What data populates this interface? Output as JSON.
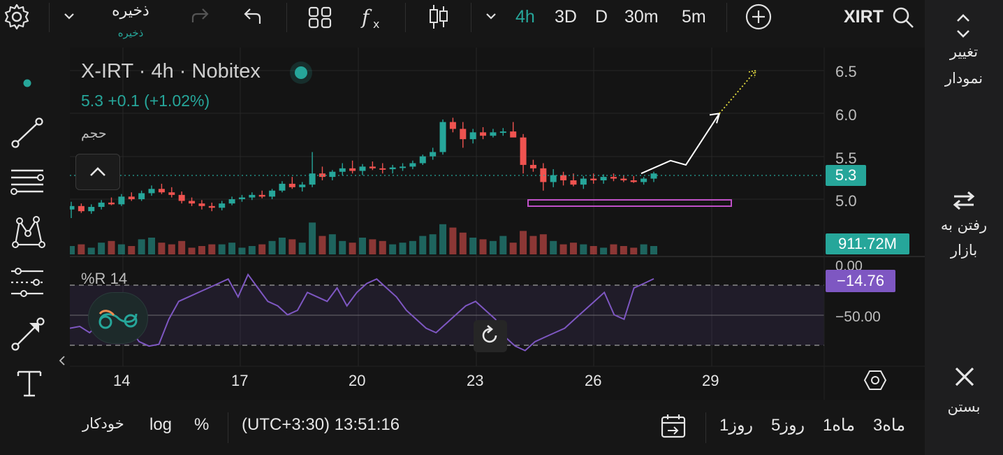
{
  "toolbar": {
    "save_label": "ذخیره",
    "save_sublabel": "ذخیره",
    "timeframes": [
      "4h",
      "3D",
      "D",
      "30m",
      "5m"
    ],
    "active_timeframe": "4h",
    "symbol": "XIRT"
  },
  "legend": {
    "title": "X-IRT",
    "interval": "4h",
    "exchange": "Nobitex",
    "last": "5.3",
    "change": "+0.1",
    "change_pct": "(+1.02%)",
    "volume_label": "حجم",
    "indicator_label": "%R",
    "indicator_period": "14"
  },
  "price_axis": {
    "ticks": [
      "6.5",
      "6.0",
      "5.5",
      "5.0"
    ],
    "last_price_badge": "5.3",
    "volume_badge": "911.72M"
  },
  "indicator_axis": {
    "ticks": [
      "0.00",
      "−50.00"
    ],
    "value_badge": "−14.76"
  },
  "time_axis": {
    "ticks": [
      "14",
      "17",
      "20",
      "23",
      "26",
      "29"
    ]
  },
  "right_panel": {
    "change_chart": [
      "تغییر",
      "نمودار"
    ],
    "go_to_market": [
      "رفتن به",
      "بازار"
    ],
    "close": "بستن"
  },
  "bottom_bar": {
    "auto": "خودکار",
    "log": "log",
    "percent": "%",
    "time": "(UTC+3:30) 13:51:16",
    "ranges": [
      "1روز",
      "5روز",
      "1ماه",
      "3ماه"
    ]
  },
  "colors": {
    "up": "#26a69a",
    "down": "#ef5350",
    "indicator": "#7e57c2",
    "accent": "#26a69a",
    "rectangle": "#c050c8"
  },
  "chart_data": {
    "type": "candlestick",
    "x_ticks": [
      "14",
      "17",
      "20",
      "23",
      "26",
      "29"
    ],
    "price_ylim": [
      4.75,
      6.6
    ],
    "williams_r_ylim": [
      -100,
      0
    ],
    "candles_ohlc": [
      [
        4.88,
        4.97,
        4.78,
        4.92
      ],
      [
        4.92,
        4.95,
        4.84,
        4.86
      ],
      [
        4.86,
        4.94,
        4.83,
        4.91
      ],
      [
        4.91,
        4.99,
        4.88,
        4.96
      ],
      [
        4.96,
        5.02,
        4.93,
        4.94
      ],
      [
        4.94,
        5.06,
        4.92,
        5.03
      ],
      [
        5.03,
        5.08,
        4.98,
        5.0
      ],
      [
        5.0,
        5.1,
        4.98,
        5.07
      ],
      [
        5.07,
        5.16,
        5.04,
        5.12
      ],
      [
        5.12,
        5.18,
        5.06,
        5.08
      ],
      [
        5.08,
        5.14,
        5.02,
        5.05
      ],
      [
        5.05,
        5.09,
        4.95,
        4.98
      ],
      [
        4.98,
        5.02,
        4.92,
        4.95
      ],
      [
        4.95,
        4.99,
        4.88,
        4.92
      ],
      [
        4.92,
        4.96,
        4.86,
        4.9
      ],
      [
        4.9,
        4.98,
        4.87,
        4.95
      ],
      [
        4.95,
        5.03,
        4.93,
        5.0
      ],
      [
        5.0,
        5.05,
        4.97,
        5.02
      ],
      [
        5.02,
        5.08,
        4.99,
        5.05
      ],
      [
        5.05,
        5.1,
        5.01,
        5.03
      ],
      [
        5.03,
        5.12,
        5.0,
        5.1
      ],
      [
        5.1,
        5.21,
        5.08,
        5.18
      ],
      [
        5.18,
        5.26,
        5.12,
        5.14
      ],
      [
        5.14,
        5.2,
        5.09,
        5.17
      ],
      [
        5.17,
        5.55,
        5.14,
        5.3
      ],
      [
        5.3,
        5.38,
        5.22,
        5.26
      ],
      [
        5.26,
        5.34,
        5.22,
        5.32
      ],
      [
        5.32,
        5.42,
        5.28,
        5.36
      ],
      [
        5.36,
        5.45,
        5.3,
        5.33
      ],
      [
        5.33,
        5.41,
        5.28,
        5.38
      ],
      [
        5.38,
        5.44,
        5.34,
        5.36
      ],
      [
        5.36,
        5.42,
        5.3,
        5.35
      ],
      [
        5.35,
        5.4,
        5.3,
        5.37
      ],
      [
        5.37,
        5.42,
        5.33,
        5.38
      ],
      [
        5.38,
        5.45,
        5.35,
        5.42
      ],
      [
        5.42,
        5.52,
        5.4,
        5.5
      ],
      [
        5.5,
        5.6,
        5.46,
        5.55
      ],
      [
        5.55,
        5.93,
        5.52,
        5.9
      ],
      [
        5.9,
        5.95,
        5.78,
        5.82
      ],
      [
        5.82,
        5.9,
        5.6,
        5.7
      ],
      [
        5.7,
        5.82,
        5.65,
        5.78
      ],
      [
        5.78,
        5.84,
        5.7,
        5.74
      ],
      [
        5.74,
        5.82,
        5.72,
        5.78
      ],
      [
        5.78,
        5.83,
        5.74,
        5.79
      ],
      [
        5.79,
        5.9,
        5.74,
        5.72
      ],
      [
        5.72,
        5.76,
        5.3,
        5.4
      ],
      [
        5.4,
        5.46,
        5.32,
        5.36
      ],
      [
        5.36,
        5.42,
        5.1,
        5.2
      ],
      [
        5.2,
        5.35,
        5.14,
        5.28
      ],
      [
        5.28,
        5.32,
        5.16,
        5.22
      ],
      [
        5.22,
        5.3,
        5.15,
        5.17
      ],
      [
        5.17,
        5.27,
        5.12,
        5.24
      ],
      [
        5.24,
        5.3,
        5.18,
        5.22
      ],
      [
        5.22,
        5.29,
        5.18,
        5.26
      ],
      [
        5.26,
        5.3,
        5.21,
        5.24
      ],
      [
        5.24,
        5.28,
        5.2,
        5.22
      ],
      [
        5.22,
        5.27,
        5.19,
        5.2
      ],
      [
        5.2,
        5.26,
        5.17,
        5.24
      ],
      [
        5.24,
        5.32,
        5.2,
        5.3
      ]
    ],
    "volume_relative": [
      0.25,
      0.3,
      0.2,
      0.35,
      0.4,
      0.3,
      0.25,
      0.45,
      0.5,
      0.35,
      0.3,
      0.4,
      0.2,
      0.25,
      0.3,
      0.3,
      0.35,
      0.2,
      0.25,
      0.3,
      0.4,
      0.5,
      0.45,
      0.35,
      0.95,
      0.55,
      0.6,
      0.4,
      0.35,
      0.5,
      0.45,
      0.4,
      0.3,
      0.35,
      0.4,
      0.55,
      0.6,
      0.9,
      0.8,
      0.65,
      0.5,
      0.45,
      0.4,
      0.55,
      0.35,
      0.7,
      0.55,
      0.6,
      0.4,
      0.3,
      0.35,
      0.3,
      0.25,
      0.2,
      0.3,
      0.25,
      0.2,
      0.3,
      0.25
    ],
    "williams_r": [
      -70,
      -68,
      -75,
      -65,
      -60,
      -55,
      -70,
      -85,
      -90,
      -88,
      -60,
      -40,
      -35,
      -30,
      -25,
      -20,
      -15,
      -35,
      -10,
      -25,
      -40,
      -45,
      -55,
      -50,
      -30,
      -35,
      -40,
      -25,
      -45,
      -30,
      -20,
      -15,
      -25,
      -35,
      -50,
      -60,
      -70,
      -75,
      -65,
      -55,
      -45,
      -40,
      -50,
      -60,
      -80,
      -90,
      -95,
      -85,
      -80,
      -75,
      -70,
      -60,
      -50,
      -40,
      -30,
      -55,
      -60,
      -25,
      -20,
      -14.76
    ],
    "forecast_line": [
      5.3,
      5.45,
      5.4,
      6.0
    ],
    "forecast_dotted_target": 6.5,
    "zone_rectangle": [
      4.96,
      5.02
    ]
  }
}
